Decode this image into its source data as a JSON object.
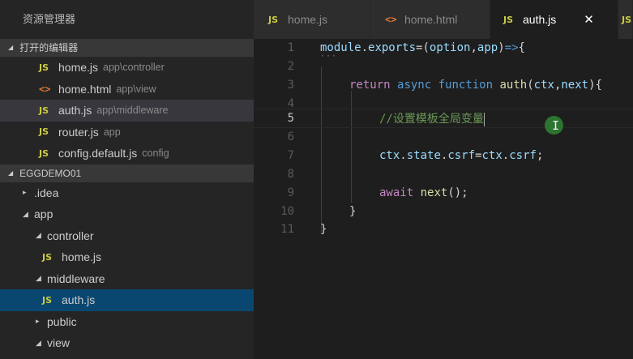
{
  "sidebar": {
    "title": "资源管理器",
    "open_editors": {
      "label": "打开的编辑器",
      "items": [
        {
          "name": "home.js",
          "path": "app\\controller",
          "icon": "JS"
        },
        {
          "name": "home.html",
          "path": "app\\view",
          "icon": "<>"
        },
        {
          "name": "auth.js",
          "path": "app\\middleware",
          "icon": "JS"
        },
        {
          "name": "router.js",
          "path": "app",
          "icon": "JS"
        },
        {
          "name": "config.default.js",
          "path": "config",
          "icon": "JS"
        }
      ]
    },
    "project": {
      "label": "EGGDEMO01",
      "tree": [
        {
          "name": ".idea",
          "twisty": "▸"
        },
        {
          "name": "app",
          "twisty": "◢"
        },
        {
          "name": "controller",
          "twisty": "◢"
        },
        {
          "name": "home.js",
          "icon": "JS"
        },
        {
          "name": "middleware",
          "twisty": "◢"
        },
        {
          "name": "auth.js",
          "icon": "JS"
        },
        {
          "name": "public",
          "twisty": "▸"
        },
        {
          "name": "view",
          "twisty": "◢"
        }
      ]
    }
  },
  "tabs": [
    {
      "label": "home.js",
      "icon": "JS"
    },
    {
      "label": "home.html",
      "icon": "<>"
    },
    {
      "label": "auth.js",
      "icon": "JS",
      "close": "✕"
    },
    {
      "label": "",
      "icon": "JS"
    }
  ],
  "editor": {
    "line_numbers": [
      "1",
      "2",
      "3",
      "4",
      "5",
      "6",
      "7",
      "8",
      "9",
      "10",
      "11"
    ],
    "current_line": 5,
    "lines": {
      "l1": {
        "a": "module",
        "b": ".",
        "c": "exports",
        "d": "=(",
        "e": "option",
        "f": ",",
        "g": "app",
        "h": ")",
        "i": "=>",
        "j": "{"
      },
      "l3": {
        "a": "return",
        "b": "async",
        "c": "function",
        "d": "auth",
        "e": "(",
        "f": "ctx",
        "g": ",",
        "h": "next",
        "i": "){"
      },
      "l5": {
        "a": "//设置模板全局变量"
      },
      "l7": {
        "a": "ctx",
        "b": ".",
        "c": "state",
        "d": ".",
        "e": "csrf",
        "f": "=",
        "g": "ctx",
        "h": ".",
        "i": "csrf",
        "j": ";"
      },
      "l9": {
        "a": "await",
        "b": "next",
        "c": "();"
      },
      "l10": {
        "a": "}"
      },
      "l11": {
        "a": "}"
      }
    },
    "fold_dots": "···",
    "ibeam_glyph": "I"
  },
  "colors": {
    "keyword": "#569cd6",
    "control": "#c586c0",
    "function": "#dcdcaa",
    "variable": "#9cdcfe",
    "comment": "#6a9955",
    "js_icon": "#cbcb41",
    "html_icon": "#e37933"
  }
}
